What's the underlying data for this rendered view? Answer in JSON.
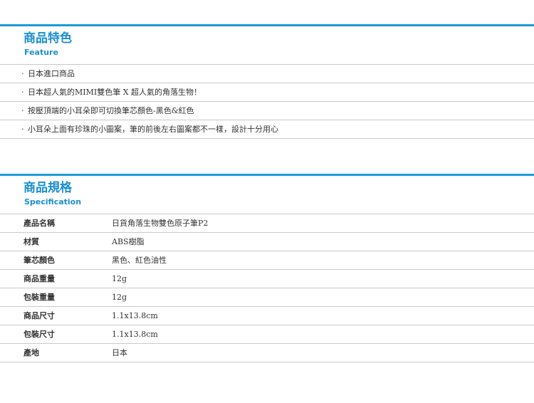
{
  "feature": {
    "title": "商品特色",
    "subtitle": "Feature",
    "items": [
      "日本進口商品",
      "日本超人氣的MIMI雙色筆 X 超人氣的角落生物！",
      "按壓頂端的小耳朵即可切換筆芯顏色-黑色&紅色",
      "小耳朵上面有珍珠的小圖案，筆的前後左右圖案都不一樣，設計十分用心"
    ]
  },
  "specification": {
    "title": "商品規格",
    "subtitle": "Specification",
    "rows": [
      {
        "label": "產品名稱",
        "value": "日貨角落生物雙色原子筆P2"
      },
      {
        "label": "材質",
        "value": "ABS樹脂"
      },
      {
        "label": "筆芯顏色",
        "value": "黑色、紅色油性"
      },
      {
        "label": "商品重量",
        "value": "12g"
      },
      {
        "label": "包裝重量",
        "value": "12g"
      },
      {
        "label": "商品尺寸",
        "value": "1.1x13.8cm"
      },
      {
        "label": "包裝尺寸",
        "value": "1.1x13.8cm"
      },
      {
        "label": "產地",
        "value": "日本"
      }
    ]
  },
  "colors": {
    "accent": "#1a9ad6",
    "divider": "#c9c9c9"
  }
}
